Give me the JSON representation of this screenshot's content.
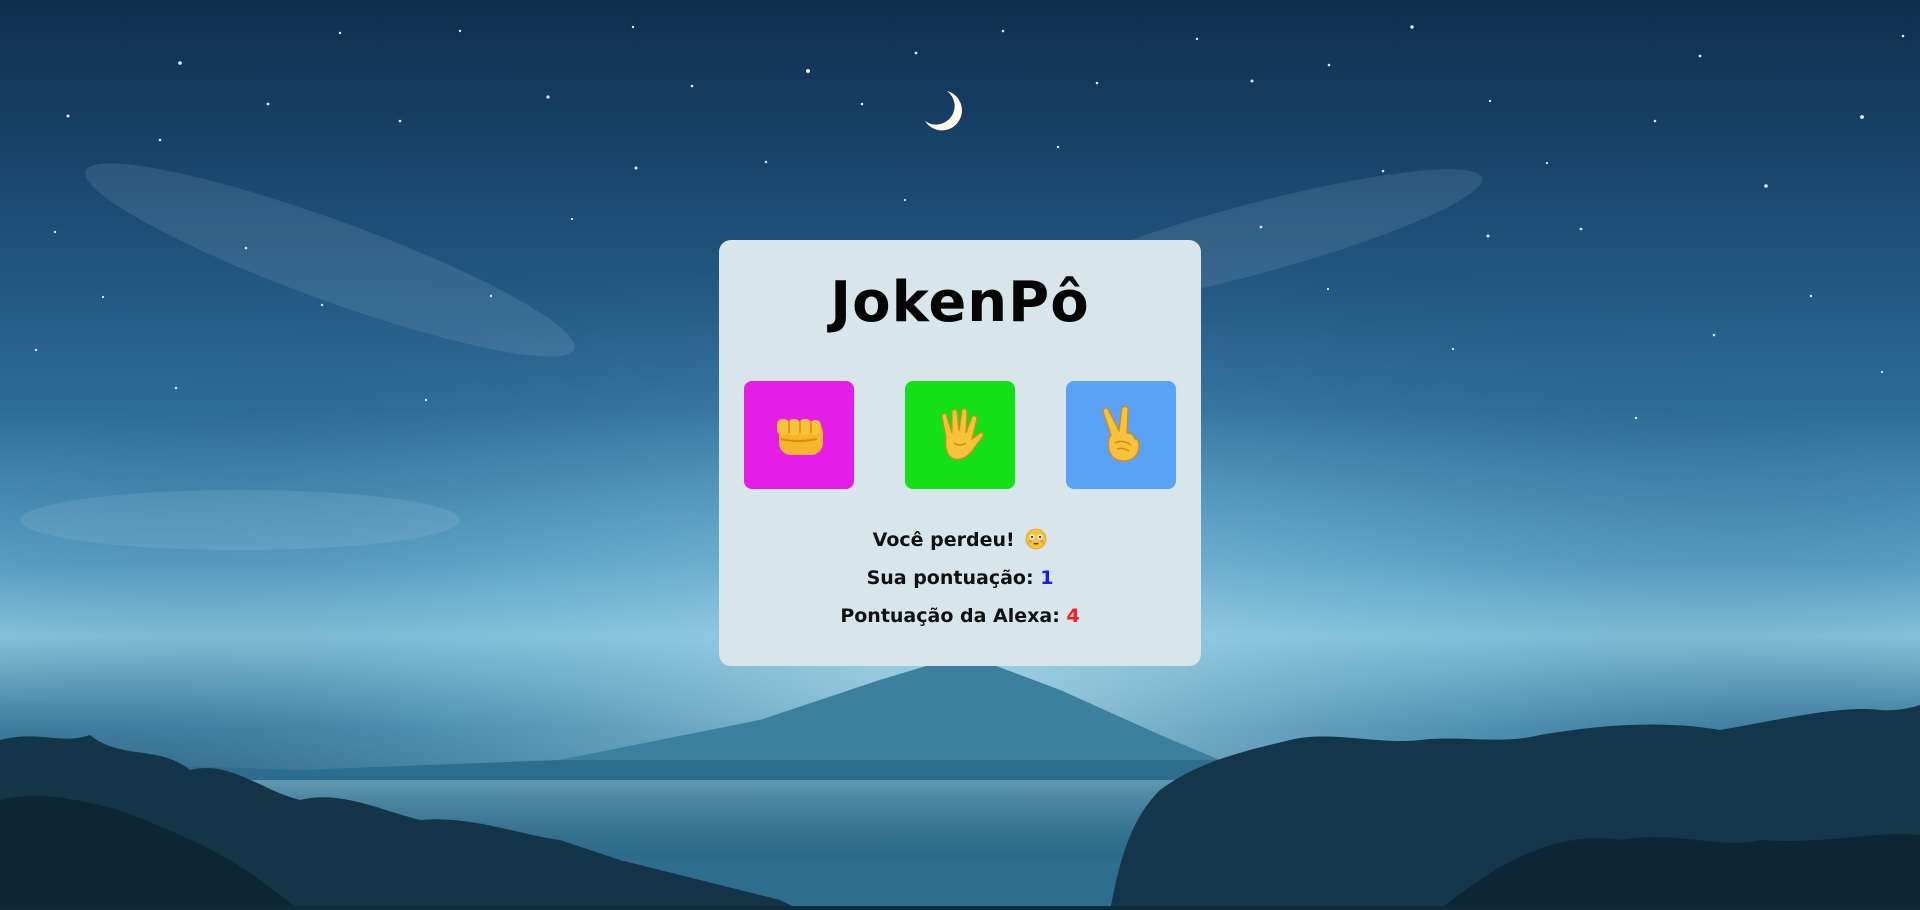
{
  "app": {
    "title": "JokenPô"
  },
  "choices": [
    {
      "name": "rock",
      "icon": "fist-icon",
      "color": "#e41de8"
    },
    {
      "name": "paper",
      "icon": "raised-hand-icon",
      "color": "#14e018"
    },
    {
      "name": "scissors",
      "icon": "victory-hand-icon",
      "color": "#5aa2f5"
    }
  ],
  "result": {
    "message": "Você perdeu!",
    "icon": "flushed-face-icon",
    "player_label": "Sua pontuação:",
    "player_score": "1",
    "player_score_color": "#1a1aff",
    "alexa_label": "Pontuação da Alexa:",
    "alexa_score": "4",
    "alexa_score_color": "#ff1a1a"
  },
  "colors": {
    "card_bg": "#d8e6ec"
  }
}
